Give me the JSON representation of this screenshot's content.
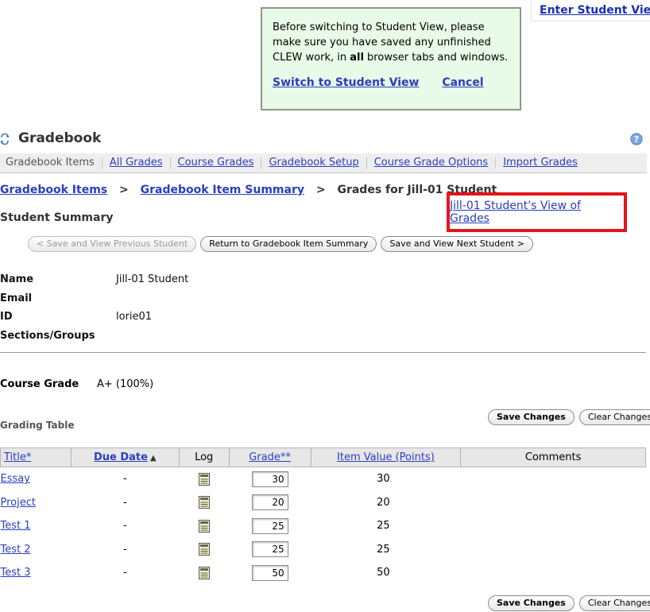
{
  "student_view_top": {
    "label": "Enter Student View"
  },
  "popup": {
    "message_pre": "Before switching to Student View, please make sure you have saved any unfinished CLEW work, in ",
    "message_bold": "all",
    "message_post": " browser tabs and windows.",
    "switch_label": "Switch to Student View",
    "cancel_label": "Cancel"
  },
  "header": {
    "title": "Gradebook"
  },
  "nav": {
    "items": [
      "Gradebook Items",
      "All Grades",
      "Course Grades",
      "Gradebook Setup",
      "Course Grade Options",
      "Import Grades"
    ]
  },
  "breadcrumb": {
    "item1": "Gradebook Items",
    "item2": "Gradebook Item Summary",
    "current": "Grades for Jill-01 Student",
    "sep": ">"
  },
  "summary": {
    "title": "Student Summary",
    "student_view_link": "Jill-01 Student's View of Grades"
  },
  "buttons": {
    "prev": "< Save and View Previous Student",
    "return": "Return to Gradebook Item Summary",
    "next": "Save and View Next Student >",
    "save_changes": "Save Changes",
    "clear_changes": "Clear Changes"
  },
  "student": {
    "name_label": "Name",
    "name": "Jill-01 Student",
    "email_label": "Email",
    "email": "",
    "id_label": "ID",
    "id": "lorie01",
    "sections_label": "Sections/Groups",
    "sections": ""
  },
  "course_grade": {
    "label": "Course Grade",
    "value": "A+ (100%)"
  },
  "grading_table": {
    "title": "Grading Table",
    "headers": {
      "title": "Title*",
      "due_date": "Due Date",
      "log": "Log",
      "grade": "Grade**",
      "item_value": "Item Value (Points)",
      "comments": "Comments"
    },
    "rows": [
      {
        "title": "Essay",
        "due": "-",
        "grade": "30",
        "value": "30"
      },
      {
        "title": "Project",
        "due": "-",
        "grade": "20",
        "value": "20"
      },
      {
        "title": "Test 1",
        "due": "-",
        "grade": "25",
        "value": "25"
      },
      {
        "title": "Test 2",
        "due": "-",
        "grade": "25",
        "value": "25"
      },
      {
        "title": "Test 3",
        "due": "-",
        "grade": "50",
        "value": "50"
      }
    ]
  },
  "colors": {
    "link": "#2b3dbf",
    "popup_bg": "#e8fbe8",
    "highlight": "#e2151b"
  }
}
